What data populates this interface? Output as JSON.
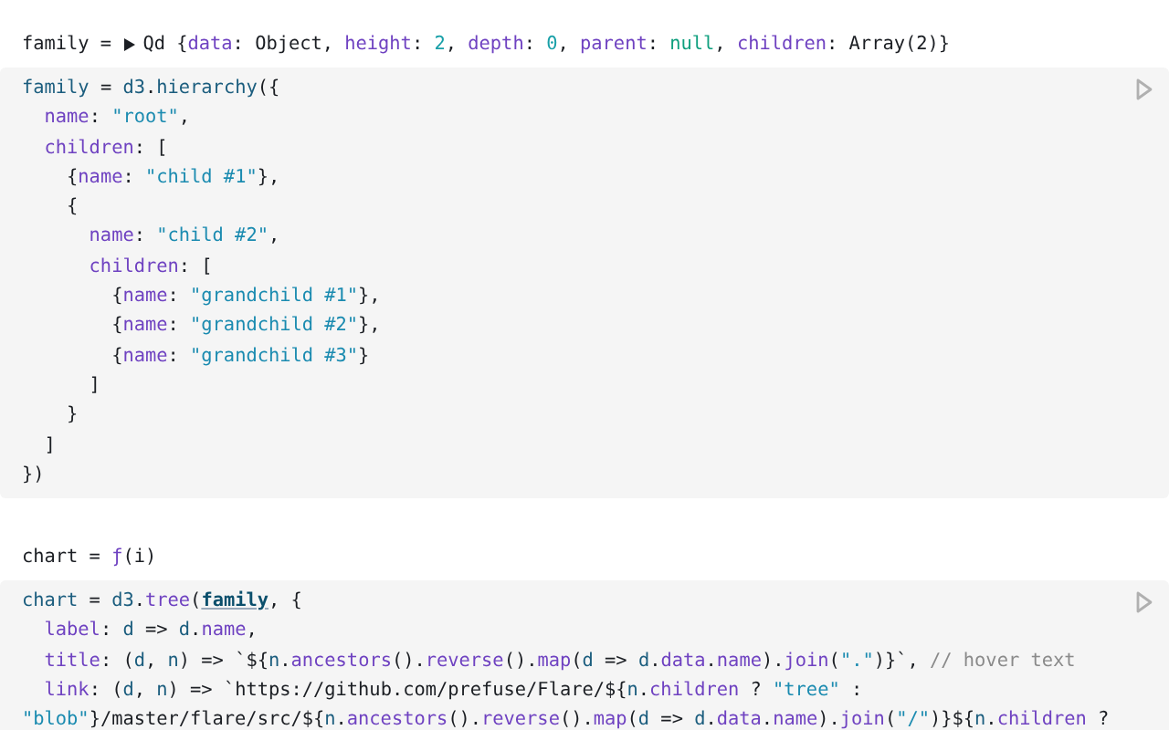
{
  "cells": [
    {
      "output": {
        "label": "family = ",
        "expanded": false,
        "tokens": [
          {
            "kind": "plain",
            "text": "Qd {"
          },
          {
            "kind": "prop",
            "text": "data"
          },
          {
            "kind": "plain",
            "text": ": Object, "
          },
          {
            "kind": "prop",
            "text": "height"
          },
          {
            "kind": "plain",
            "text": ": "
          },
          {
            "kind": "number",
            "text": "2"
          },
          {
            "kind": "plain",
            "text": ", "
          },
          {
            "kind": "prop",
            "text": "depth"
          },
          {
            "kind": "plain",
            "text": ": "
          },
          {
            "kind": "number",
            "text": "0"
          },
          {
            "kind": "plain",
            "text": ", "
          },
          {
            "kind": "prop",
            "text": "parent"
          },
          {
            "kind": "plain",
            "text": ": "
          },
          {
            "kind": "null",
            "text": "null"
          },
          {
            "kind": "plain",
            "text": ", "
          },
          {
            "kind": "prop",
            "text": "children"
          },
          {
            "kind": "plain",
            "text": ": Array(2)}"
          }
        ]
      },
      "code": [
        [
          {
            "kind": "var",
            "text": "family"
          },
          {
            "kind": "plain",
            "text": " = "
          },
          {
            "kind": "var",
            "text": "d3"
          },
          {
            "kind": "plain",
            "text": "."
          },
          {
            "kind": "var",
            "text": "hierarchy"
          },
          {
            "kind": "plain",
            "text": "({"
          }
        ],
        [
          {
            "kind": "prop",
            "text": "  name"
          },
          {
            "kind": "plain",
            "text": ": "
          },
          {
            "kind": "string",
            "text": "\"root\""
          },
          {
            "kind": "plain",
            "text": ","
          }
        ],
        [
          {
            "kind": "prop",
            "text": "  children"
          },
          {
            "kind": "plain",
            "text": ": ["
          }
        ],
        [
          {
            "kind": "plain",
            "text": "    {"
          },
          {
            "kind": "prop",
            "text": "name"
          },
          {
            "kind": "plain",
            "text": ": "
          },
          {
            "kind": "string",
            "text": "\"child #1\""
          },
          {
            "kind": "plain",
            "text": "},"
          }
        ],
        [
          {
            "kind": "plain",
            "text": "    {"
          }
        ],
        [
          {
            "kind": "prop",
            "text": "      name"
          },
          {
            "kind": "plain",
            "text": ": "
          },
          {
            "kind": "string",
            "text": "\"child #2\""
          },
          {
            "kind": "plain",
            "text": ","
          }
        ],
        [
          {
            "kind": "prop",
            "text": "      children"
          },
          {
            "kind": "plain",
            "text": ": ["
          }
        ],
        [
          {
            "kind": "plain",
            "text": "        {"
          },
          {
            "kind": "prop",
            "text": "name"
          },
          {
            "kind": "plain",
            "text": ": "
          },
          {
            "kind": "string",
            "text": "\"grandchild #1\""
          },
          {
            "kind": "plain",
            "text": "},"
          }
        ],
        [
          {
            "kind": "plain",
            "text": "        {"
          },
          {
            "kind": "prop",
            "text": "name"
          },
          {
            "kind": "plain",
            "text": ": "
          },
          {
            "kind": "string",
            "text": "\"grandchild #2\""
          },
          {
            "kind": "plain",
            "text": "},"
          }
        ],
        [
          {
            "kind": "plain",
            "text": "        {"
          },
          {
            "kind": "prop",
            "text": "name"
          },
          {
            "kind": "plain",
            "text": ": "
          },
          {
            "kind": "string",
            "text": "\"grandchild #3\""
          },
          {
            "kind": "plain",
            "text": "}"
          }
        ],
        [
          {
            "kind": "plain",
            "text": "      ]"
          }
        ],
        [
          {
            "kind": "plain",
            "text": "    }"
          }
        ],
        [
          {
            "kind": "plain",
            "text": "  ]"
          }
        ],
        [
          {
            "kind": "plain",
            "text": "})"
          }
        ]
      ]
    },
    {
      "output": {
        "label": "chart = ",
        "tokens": [
          {
            "kind": "prop",
            "text": "ƒ"
          },
          {
            "kind": "plain",
            "text": "(i)"
          }
        ]
      },
      "code": [
        [
          {
            "kind": "var",
            "text": "chart"
          },
          {
            "kind": "plain",
            "text": " = "
          },
          {
            "kind": "var",
            "text": "d3"
          },
          {
            "kind": "plain",
            "text": "."
          },
          {
            "kind": "prop",
            "text": "tree"
          },
          {
            "kind": "plain",
            "text": "("
          },
          {
            "kind": "link",
            "text": "family"
          },
          {
            "kind": "plain",
            "text": ", {"
          }
        ],
        [
          {
            "kind": "prop",
            "text": "  label"
          },
          {
            "kind": "plain",
            "text": ": "
          },
          {
            "kind": "var",
            "text": "d"
          },
          {
            "kind": "plain",
            "text": " => "
          },
          {
            "kind": "var",
            "text": "d"
          },
          {
            "kind": "plain",
            "text": "."
          },
          {
            "kind": "prop",
            "text": "name"
          },
          {
            "kind": "plain",
            "text": ","
          }
        ],
        [
          {
            "kind": "prop",
            "text": "  title"
          },
          {
            "kind": "plain",
            "text": ": ("
          },
          {
            "kind": "var",
            "text": "d"
          },
          {
            "kind": "plain",
            "text": ", "
          },
          {
            "kind": "var",
            "text": "n"
          },
          {
            "kind": "plain",
            "text": ") => `${"
          },
          {
            "kind": "var",
            "text": "n"
          },
          {
            "kind": "plain",
            "text": "."
          },
          {
            "kind": "prop",
            "text": "ancestors"
          },
          {
            "kind": "plain",
            "text": "()."
          },
          {
            "kind": "prop",
            "text": "reverse"
          },
          {
            "kind": "plain",
            "text": "()."
          },
          {
            "kind": "prop",
            "text": "map"
          },
          {
            "kind": "plain",
            "text": "("
          },
          {
            "kind": "var",
            "text": "d"
          },
          {
            "kind": "plain",
            "text": " => "
          },
          {
            "kind": "var",
            "text": "d"
          },
          {
            "kind": "plain",
            "text": "."
          },
          {
            "kind": "prop",
            "text": "data"
          },
          {
            "kind": "plain",
            "text": "."
          },
          {
            "kind": "prop",
            "text": "name"
          },
          {
            "kind": "plain",
            "text": ")."
          },
          {
            "kind": "prop",
            "text": "join"
          },
          {
            "kind": "plain",
            "text": "("
          },
          {
            "kind": "string",
            "text": "\".\""
          },
          {
            "kind": "plain",
            "text": ")}`, "
          },
          {
            "kind": "comment",
            "text": "// hover text"
          }
        ],
        [
          {
            "kind": "prop",
            "text": "  link"
          },
          {
            "kind": "plain",
            "text": ": ("
          },
          {
            "kind": "var",
            "text": "d"
          },
          {
            "kind": "plain",
            "text": ", "
          },
          {
            "kind": "var",
            "text": "n"
          },
          {
            "kind": "plain",
            "text": ") => `https://github.com/prefuse/Flare/${"
          },
          {
            "kind": "var",
            "text": "n"
          },
          {
            "kind": "plain",
            "text": "."
          },
          {
            "kind": "prop",
            "text": "children"
          },
          {
            "kind": "plain",
            "text": " ? "
          },
          {
            "kind": "string",
            "text": "\"tree\""
          },
          {
            "kind": "plain",
            "text": " :"
          }
        ],
        [
          {
            "kind": "string",
            "text": "\"blob\""
          },
          {
            "kind": "plain",
            "text": "}/master/flare/src/${"
          },
          {
            "kind": "var",
            "text": "n"
          },
          {
            "kind": "plain",
            "text": "."
          },
          {
            "kind": "prop",
            "text": "ancestors"
          },
          {
            "kind": "plain",
            "text": "()."
          },
          {
            "kind": "prop",
            "text": "reverse"
          },
          {
            "kind": "plain",
            "text": "()."
          },
          {
            "kind": "prop",
            "text": "map"
          },
          {
            "kind": "plain",
            "text": "("
          },
          {
            "kind": "var",
            "text": "d"
          },
          {
            "kind": "plain",
            "text": " => "
          },
          {
            "kind": "var",
            "text": "d"
          },
          {
            "kind": "plain",
            "text": "."
          },
          {
            "kind": "prop",
            "text": "data"
          },
          {
            "kind": "plain",
            "text": "."
          },
          {
            "kind": "prop",
            "text": "name"
          },
          {
            "kind": "plain",
            "text": ")."
          },
          {
            "kind": "prop",
            "text": "join"
          },
          {
            "kind": "plain",
            "text": "("
          },
          {
            "kind": "string",
            "text": "\"/\""
          },
          {
            "kind": "plain",
            "text": ")}${"
          },
          {
            "kind": "var",
            "text": "n"
          },
          {
            "kind": "plain",
            "text": "."
          },
          {
            "kind": "prop",
            "text": "children"
          },
          {
            "kind": "plain",
            "text": " ?"
          }
        ]
      ]
    }
  ]
}
